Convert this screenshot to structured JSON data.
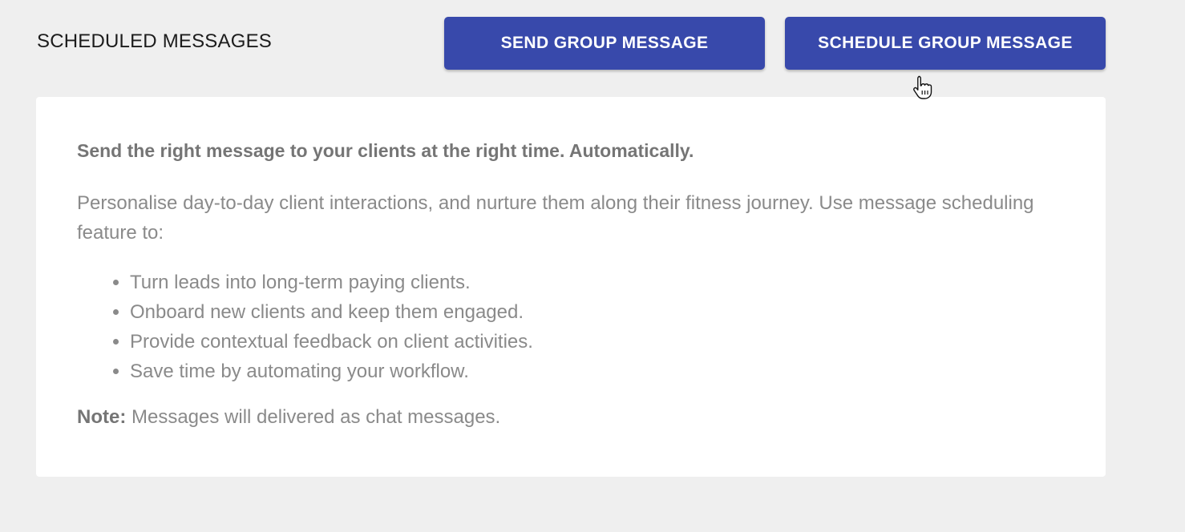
{
  "header": {
    "title": "SCHEDULED MESSAGES"
  },
  "actions": {
    "send_group_label": "SEND GROUP MESSAGE",
    "schedule_group_label": "SCHEDULE GROUP MESSAGE",
    "button_color": "#3849ab"
  },
  "info_card": {
    "heading": "Send the right message to your clients at the right time. Automatically.",
    "intro": "Personalise day-to-day client interactions, and nurture them along their fitness journey. Use message scheduling feature to:",
    "bullets": [
      "Turn leads into long-term paying clients.",
      "Onboard new clients and keep them engaged.",
      "Provide contextual feedback on client activities.",
      "Save time by automating your workflow."
    ],
    "note_label": "Note:",
    "note_text": " Messages will delivered as chat messages."
  },
  "cursor": {
    "icon": "hand-pointer-icon"
  }
}
